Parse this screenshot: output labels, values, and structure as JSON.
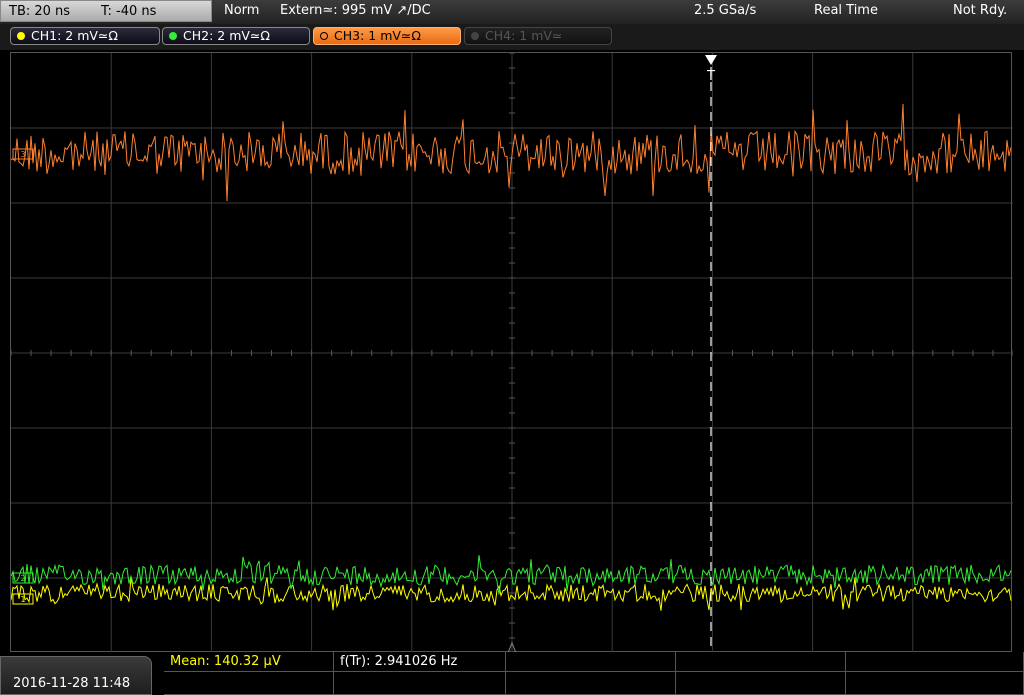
{
  "status": {
    "timebase": "TB: 20 ns",
    "trigger_time": "T: -40 ns",
    "mode": "Norm",
    "trigger": "Extern≃: 995 mV ↗/DC",
    "sample_rate": "2.5 GSa/s",
    "acq_mode": "Real Time",
    "state": "Not Rdy."
  },
  "channels": [
    {
      "label": "CH1: 2 mV≃Ω",
      "color": "#ffff00",
      "active": false,
      "enabled": true
    },
    {
      "label": "CH2: 2 mV≃Ω",
      "color": "#33ee33",
      "active": false,
      "enabled": true
    },
    {
      "label": "CH3: 1 mV≃Ω",
      "color": "#ff8030",
      "active": true,
      "enabled": true
    },
    {
      "label": "CH4: 1 mV≃",
      "color": "#555555",
      "active": false,
      "enabled": false
    }
  ],
  "trigger_marker": "T",
  "markers": {
    "ch3": "3",
    "ch2": "2",
    "ch1": "1"
  },
  "colors": {
    "ch1": "#ffff00",
    "ch2": "#33ee33",
    "ch3": "#ff8030",
    "grid": "#444444"
  },
  "datetime": "2016-11-28 11:48",
  "measurements": {
    "mean": "Mean: 140.32 µV",
    "freq": "f(Tr): 2.941026 Hz"
  }
}
